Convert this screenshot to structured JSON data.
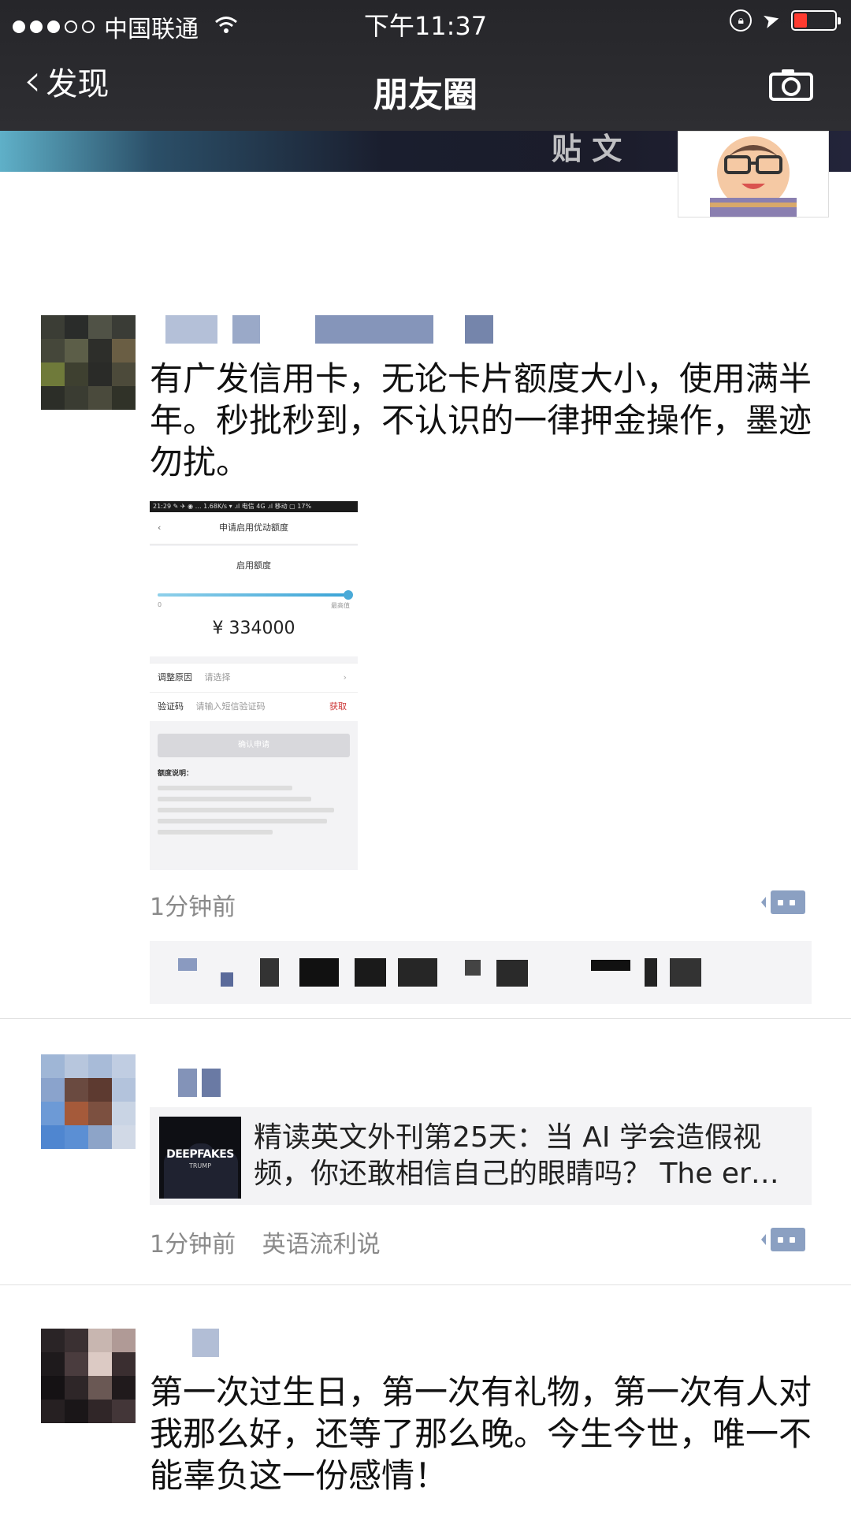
{
  "status_bar": {
    "carrier": "中国联通",
    "time": "下午11:37"
  },
  "nav": {
    "back_label": "发现",
    "title": "朋友圈"
  },
  "cover": {
    "text": "贴 文"
  },
  "posts": [
    {
      "text": "有广发信用卡，无论卡片额度大小，使用满半年。秒批秒到，不认识的一律押金操作，墨迹勿扰。",
      "time": "1分钟前",
      "screenshot": {
        "status": "21:29 ✎ ✈ ◉ … 1.68K/s ▾ .ıl 电信 4G .ıl 移动 ▢ 17%",
        "back": "‹",
        "title": "申请启用优动额度",
        "label": "启用额度",
        "min": "0",
        "max": "最高值",
        "amount": "¥ 334000",
        "slider_fraction": 1.0,
        "row1_label": "调整原因",
        "row1_value": "请选择",
        "row1_right": "›",
        "row2_label": "验证码",
        "row2_value": "请输入短信验证码",
        "row2_right": "获取",
        "button": "确认申请",
        "rules_title": "额度说明："
      }
    },
    {
      "link_title": "精读英文外刊第25天：当 AI 学会造假视频，你还敢相信自己的眼睛吗？ The er…",
      "thumb_text": "DEEPFAKES",
      "thumb_sub": "TRUMP",
      "time": "1分钟前",
      "source": "英语流利说"
    },
    {
      "text": "第一次过生日，第一次有礼物，第一次有人对我那么好，还等了那么晚。今生今世，唯一不能辜负这一份感情！"
    }
  ]
}
